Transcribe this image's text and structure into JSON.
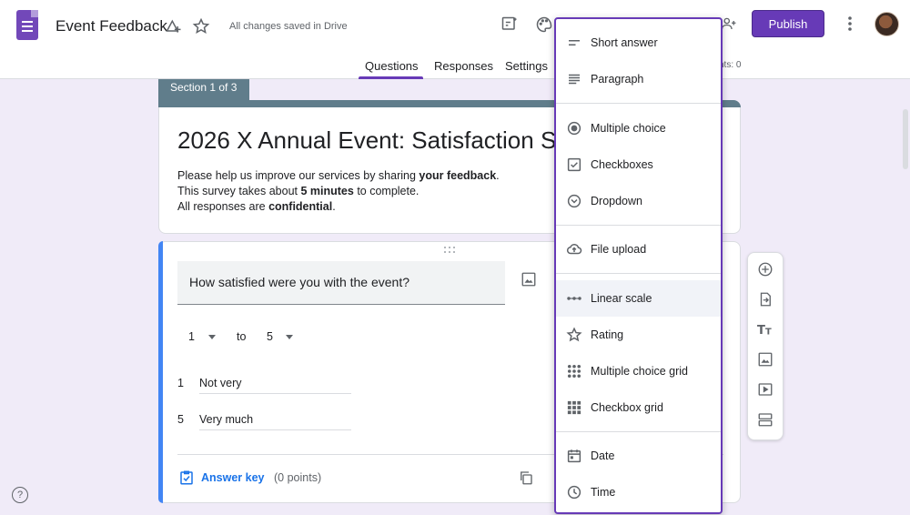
{
  "header": {
    "title": "Event Feedback",
    "saved_status": "All changes saved in Drive",
    "publish_label": "Publish",
    "tabs": [
      {
        "label": "Questions"
      },
      {
        "label": "Responses"
      },
      {
        "label": "Settings"
      }
    ],
    "points_partial": "nts: 0",
    "active_tab": "Questions",
    "accent_color": "#673ab7"
  },
  "section": {
    "tab_label": "Section 1 of 3",
    "title": "2026 X Annual Event: Satisfaction S",
    "desc_parts": [
      [
        "Please help us improve our services by sharing ",
        "your feedback",
        "."
      ],
      [
        "This survey takes about ",
        "5 minutes",
        " to complete."
      ],
      [
        "All responses are ",
        "confidential",
        "."
      ]
    ]
  },
  "question": {
    "text": "How satisfied were you with the event?",
    "scale_min": "1",
    "to_label": "to",
    "scale_max": "5",
    "low_num": "1",
    "low_label": "Not very",
    "high_num": "5",
    "high_label": "Very much",
    "answer_key_label": "Answer key",
    "points_label": "(0 points)"
  },
  "menu": {
    "items": [
      {
        "label": "Short answer",
        "icon": "short-answer-icon"
      },
      {
        "label": "Paragraph",
        "icon": "paragraph-icon"
      },
      {
        "label": "Multiple choice",
        "icon": "radio-icon"
      },
      {
        "label": "Checkboxes",
        "icon": "checkbox-icon"
      },
      {
        "label": "Dropdown",
        "icon": "dropdown-icon"
      },
      {
        "label": "File upload",
        "icon": "cloud-upload-icon"
      },
      {
        "label": "Linear scale",
        "icon": "linear-scale-icon",
        "highlighted": true
      },
      {
        "label": "Rating",
        "icon": "star-icon"
      },
      {
        "label": "Multiple choice grid",
        "icon": "grid-dots-icon"
      },
      {
        "label": "Checkbox grid",
        "icon": "grid-squares-icon"
      },
      {
        "label": "Date",
        "icon": "calendar-icon"
      },
      {
        "label": "Time",
        "icon": "clock-icon"
      }
    ]
  },
  "toolbar": {
    "icons": [
      "add-question-icon",
      "import-questions-icon",
      "add-title-icon",
      "add-image-icon",
      "add-video-icon",
      "add-section-icon"
    ]
  },
  "help_label": "?"
}
